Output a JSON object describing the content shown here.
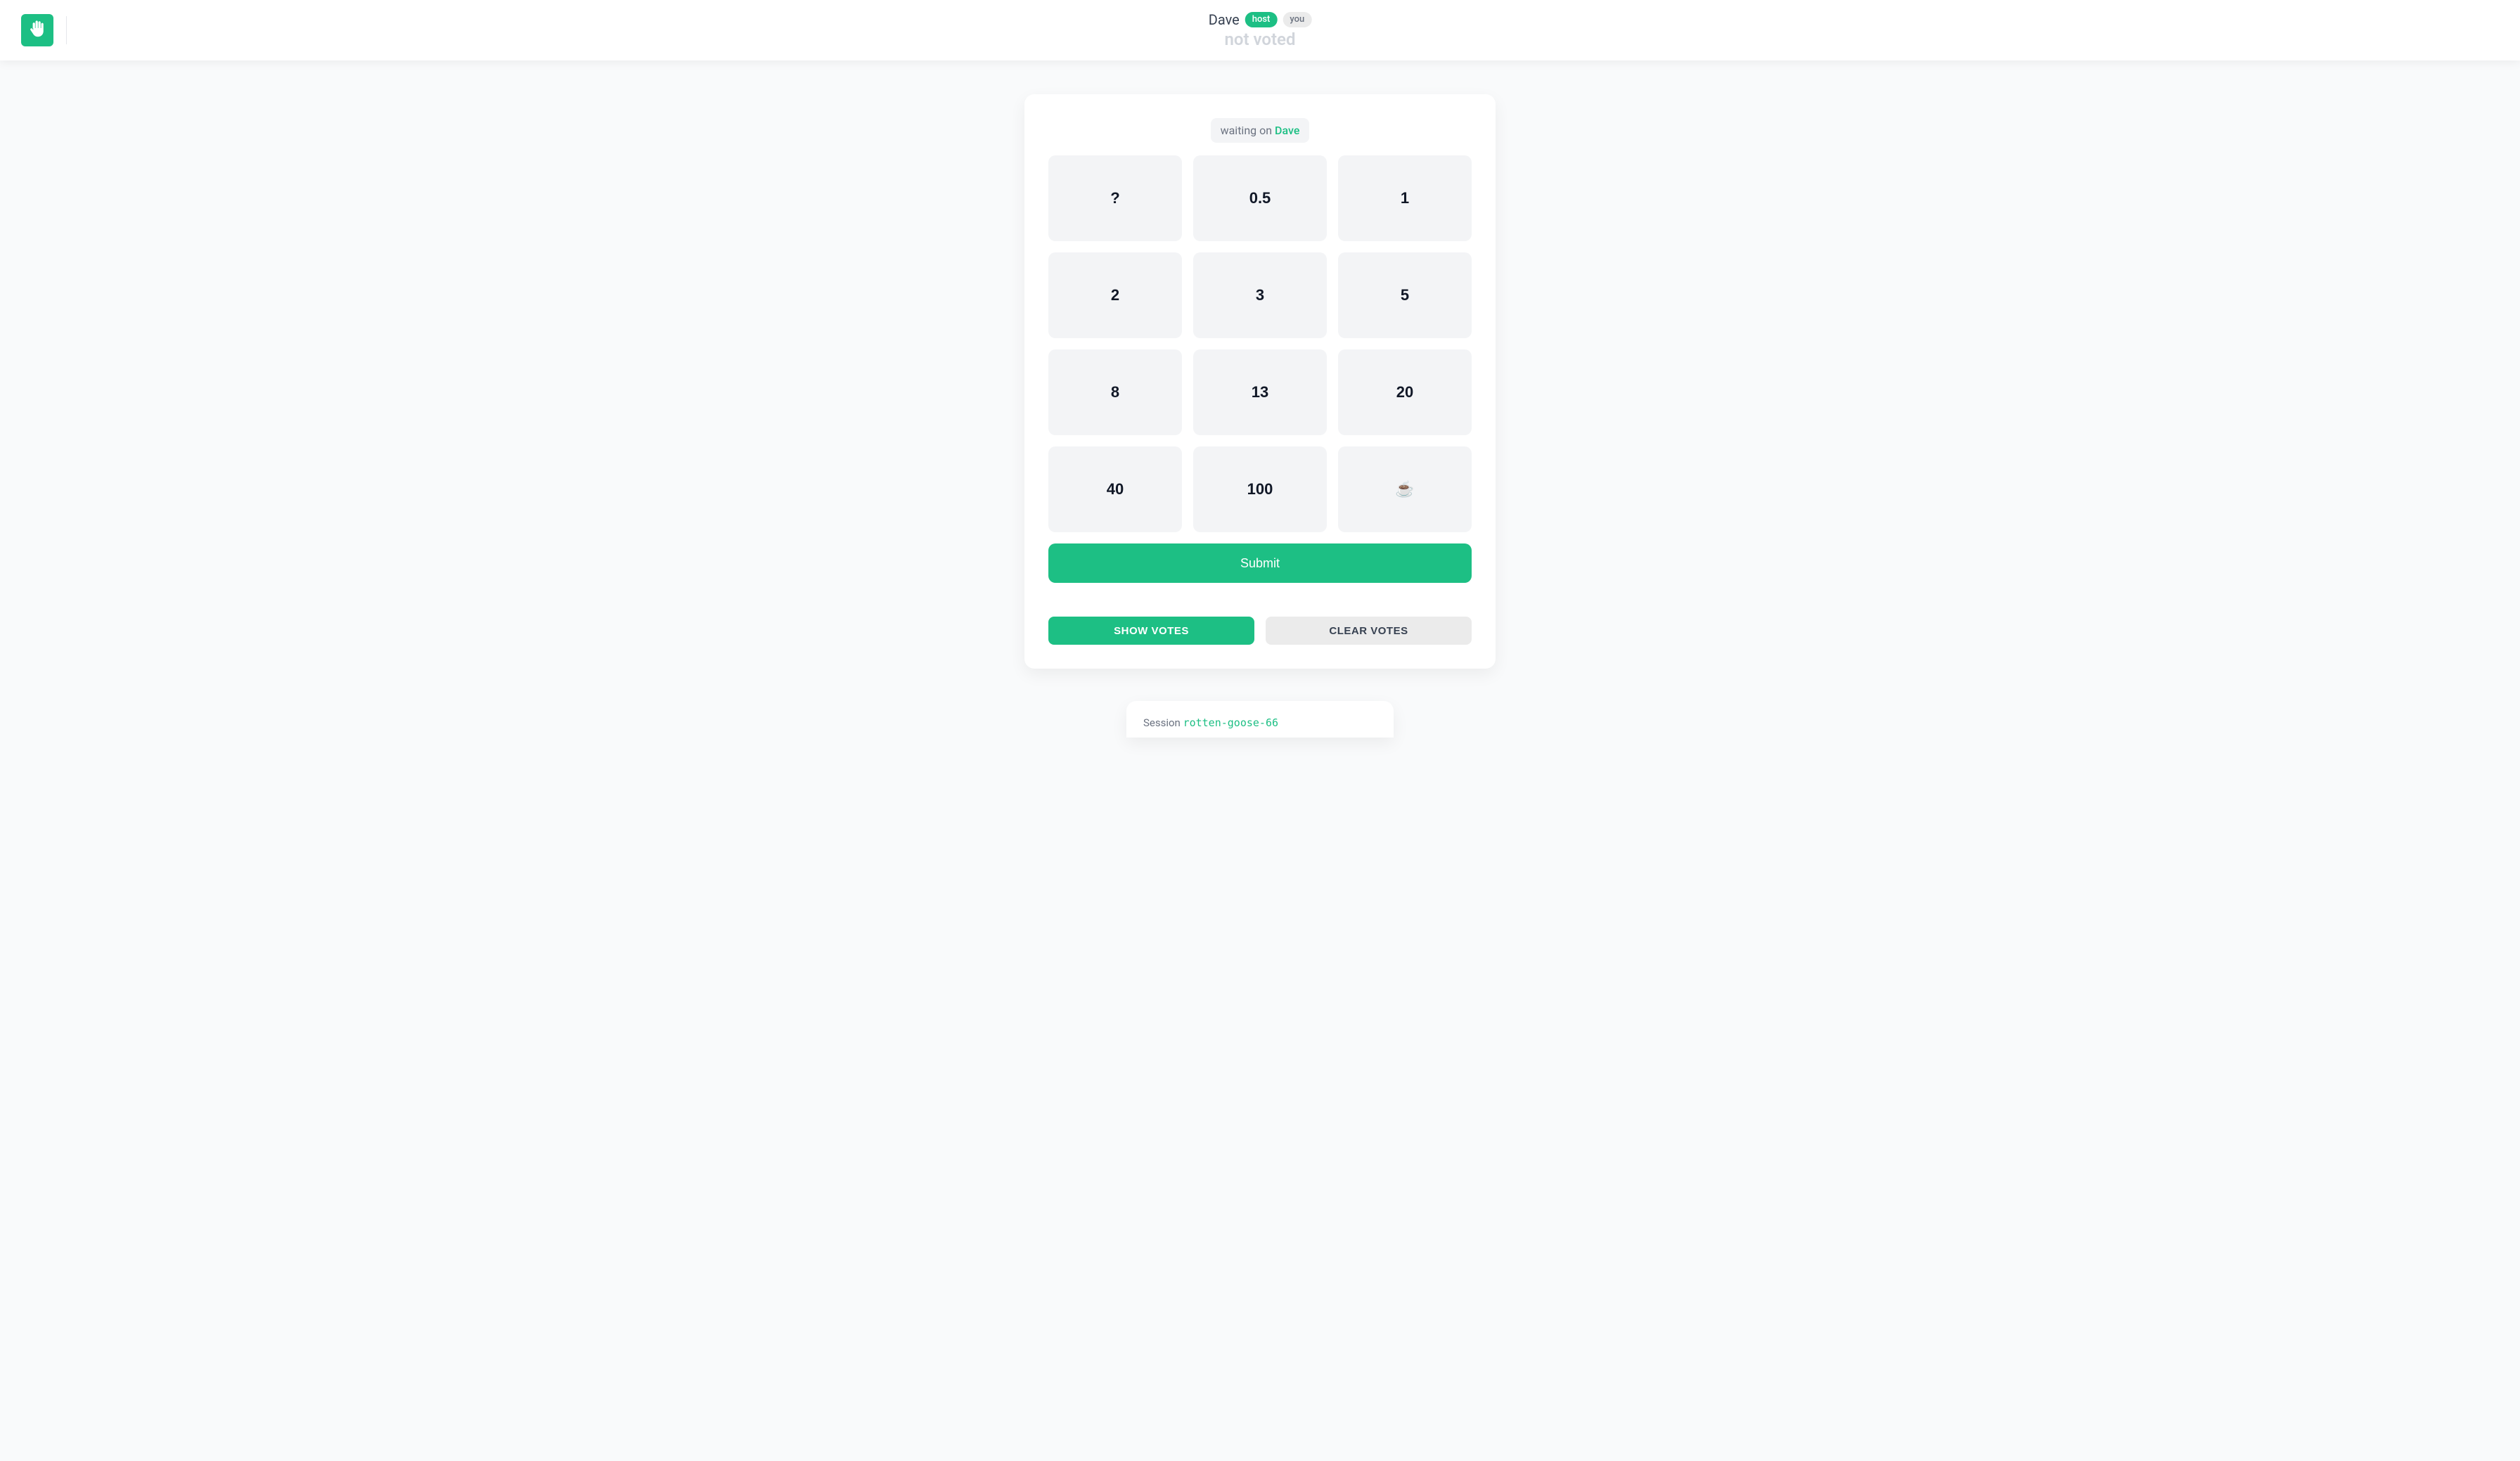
{
  "header": {
    "user_name": "Dave",
    "host_badge": "host",
    "you_badge": "you",
    "vote_status": "not voted"
  },
  "waiting": {
    "prefix": "waiting on ",
    "name": "Dave"
  },
  "cards": [
    "?",
    "0.5",
    "1",
    "2",
    "3",
    "5",
    "8",
    "13",
    "20",
    "40",
    "100",
    "☕"
  ],
  "buttons": {
    "submit": "Submit",
    "show_votes": "SHOW VOTES",
    "clear_votes": "CLEAR VOTES"
  },
  "session": {
    "label": "Session ",
    "id": "rotten-goose-66"
  },
  "colors": {
    "accent": "#1dbf84",
    "muted_bg": "#f3f4f6",
    "page_bg": "#f9fafb"
  }
}
